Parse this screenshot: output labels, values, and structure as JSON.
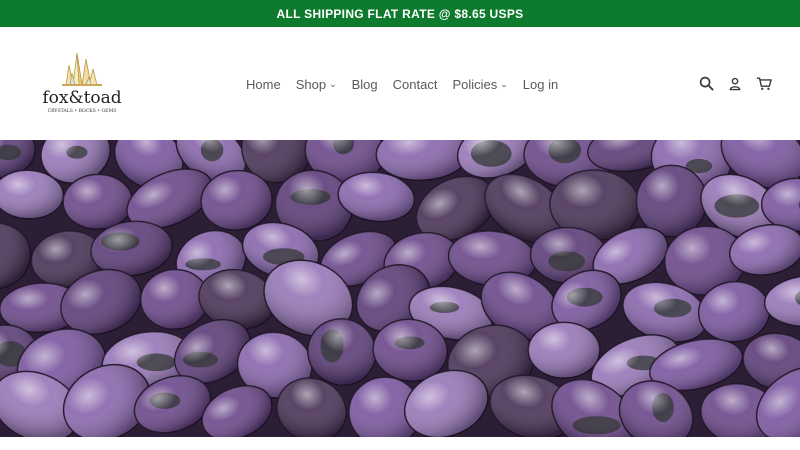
{
  "announcement": {
    "text": "ALL SHIPPING FLAT RATE @ $8.65 USPS",
    "bg_color": "#0d7a2e"
  },
  "brand": {
    "name": "fox&toad",
    "tagline": "CRYSTALS • ROCKS • GEMS",
    "icon": "crystal-cluster-logo"
  },
  "nav": {
    "items": [
      {
        "label": "Home",
        "dropdown": false
      },
      {
        "label": "Shop",
        "dropdown": true
      },
      {
        "label": "Blog",
        "dropdown": false
      },
      {
        "label": "Contact",
        "dropdown": false
      },
      {
        "label": "Policies",
        "dropdown": true
      },
      {
        "label": "Log in",
        "dropdown": false
      }
    ],
    "chevron_glyph": "⌄"
  },
  "header_icons": [
    "search-icon",
    "account-icon",
    "cart-icon"
  ],
  "hero": {
    "alt": "Tumbled charoite stones",
    "palette": [
      "#6d4a8c",
      "#7b58a0",
      "#8a68ae",
      "#5e3f7a",
      "#9878b8",
      "#4b3458"
    ]
  }
}
